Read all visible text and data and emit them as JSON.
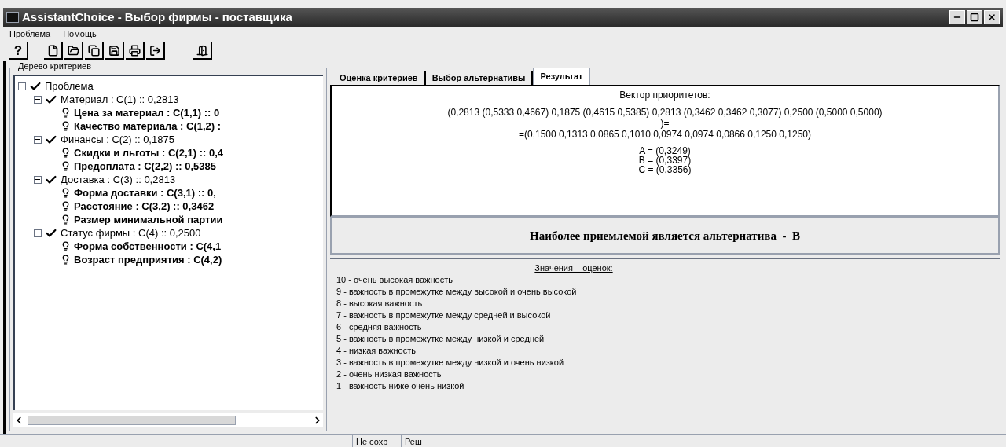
{
  "window": {
    "title": "AssistantChoice - Выбор фирмы - поставщика"
  },
  "menu": [
    {
      "label": "Проблема"
    },
    {
      "label": "Помощь"
    }
  ],
  "toolbar": {
    "help_label": "?"
  },
  "tree": {
    "title": "Дерево критериев",
    "root": {
      "label": "Проблема",
      "expanded": true,
      "children": [
        {
          "label": "Материал : C(1) :: 0,2813",
          "expanded": true,
          "children": [
            {
              "label": "Цена за материал : C(1,1) :: 0"
            },
            {
              "label": "Качество материала : C(1,2) :"
            }
          ]
        },
        {
          "label": "Финансы : C(2) :: 0,1875",
          "expanded": true,
          "children": [
            {
              "label": "Скидки и льготы : C(2,1) :: 0,4"
            },
            {
              "label": "Предоплата : C(2,2) :: 0,5385"
            }
          ]
        },
        {
          "label": "Доставка : C(3) :: 0,2813",
          "expanded": true,
          "children": [
            {
              "label": "Форма доставки : C(3,1) :: 0,"
            },
            {
              "label": "Расстояние : C(3,2) :: 0,3462"
            },
            {
              "label": "Размер минимальной партии"
            }
          ]
        },
        {
          "label": "Статус фирмы : C(4) :: 0,2500",
          "expanded": true,
          "children": [
            {
              "label": "Форма собственности : C(4,1"
            },
            {
              "label": "Возраст предприятия : C(4,2)"
            }
          ]
        }
      ]
    }
  },
  "tabs": [
    {
      "label": "Оценка критериев",
      "selected": false
    },
    {
      "label": "Выбор альтернативы",
      "selected": false
    },
    {
      "label": "Результат",
      "selected": true
    }
  ],
  "result": {
    "heading": "Вектор приоритетов:",
    "lines": [
      "(0,2813 (0,5333 0,4667) 0,1875 (0,4615 0,5385) 0,2813 (0,3462 0,3462 0,3077) 0,2500 (0,5000 0,5000)",
      ")=",
      "=(0,1500 0,1313 0,0865 0,1010 0,0974 0,0974 0,0866 0,1250 0,1250)"
    ],
    "alternatives": [
      "A = (0,3249)",
      "B = (0,3397)",
      "C = (0,3356)"
    ],
    "conclusion": "Наиболее приемлемой является альтернатива  -  B"
  },
  "scale": {
    "title": "Значения    оценок:",
    "items": [
      "10 - очень высокая важность",
      "9 - важность в промежутке между высокой и очень высокой",
      "8 - высокая важность",
      "7 - важность в промежутке между средней и высокой",
      "6 - средняя важность",
      "5 - важность в промежутке между низкой и средней",
      "4 - низкая важность",
      "3 - важность в промежутке между низкой и очень низкой",
      "2 - очень низкая важность",
      "1 - важность ниже очень низкой"
    ]
  },
  "status_bar": [
    "Не сохр",
    "Реш"
  ]
}
